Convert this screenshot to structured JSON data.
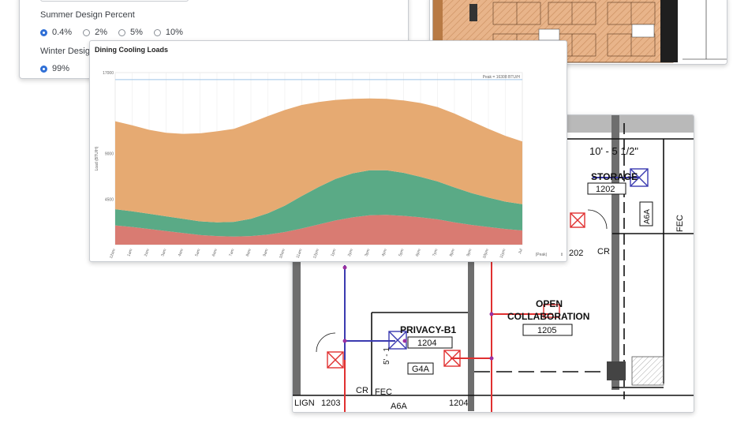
{
  "settings": {
    "summer_label": "Summer Design Percent",
    "summer_options": [
      "0.4%",
      "2%",
      "5%",
      "10%"
    ],
    "summer_selected": "0.4%",
    "winter_label": "Winter Design Percent",
    "winter_options": [
      "99%"
    ],
    "winter_selected": "99%"
  },
  "plan_thumb": {
    "labels": [
      "STORAGE",
      "OPEN\nCOLLABORATION"
    ],
    "accent": "#d9a172"
  },
  "floor_plan": {
    "rooms": [
      {
        "name": "STORAGE",
        "number": "1202"
      },
      {
        "name": "OPEN",
        "number": ""
      },
      {
        "name": "COLLABORATION",
        "number": "1205"
      },
      {
        "name": "PRIVACY-B1",
        "number": "1204"
      }
    ],
    "dimension": "10' - 5 1/2\"",
    "tags": [
      "A6A",
      "FEC",
      "CR",
      "202",
      "G4A",
      "CR",
      "FEC",
      "A6A",
      "1204",
      "1203",
      "LIGN",
      "5' - 1"
    ],
    "duct_colors": {
      "supply": "#e03030",
      "return": "#3a3ab0"
    }
  },
  "chart": {
    "title": "Dining Cooling Loads",
    "peak_label": "Peak = 16308 BTU/H",
    "ylabel": "Load (BTU/H)",
    "last_tick_sub": "(Peak)"
  },
  "chart_data": {
    "type": "area",
    "title": "Dining Cooling Loads",
    "ylabel": "Load (BTU/H)",
    "xlabel": "",
    "ylim": [
      0,
      17000
    ],
    "yticks": [
      4500,
      9000,
      17000
    ],
    "peak_value": 16308,
    "categories": [
      "12am",
      "1am",
      "2am",
      "3am",
      "4am",
      "5am",
      "6am",
      "7am",
      "8am",
      "9am",
      "10am",
      "11am",
      "12pm",
      "1pm",
      "2pm",
      "3pm",
      "4pm",
      "5pm",
      "6pm",
      "7pm",
      "8pm",
      "9pm",
      "10pm",
      "11pm",
      "Jul"
    ],
    "series": [
      {
        "color": "#d97b72",
        "values": [
          1900,
          1750,
          1550,
          1350,
          1150,
          950,
          850,
          800,
          850,
          1000,
          1250,
          1600,
          2000,
          2400,
          2700,
          2900,
          2950,
          2850,
          2700,
          2500,
          2200,
          1950,
          1750,
          1550,
          1400
        ]
      },
      {
        "color": "#5aaa86",
        "values": [
          1600,
          1550,
          1500,
          1450,
          1400,
          1350,
          1350,
          1450,
          1700,
          2100,
          2600,
          3200,
          3700,
          4100,
          4350,
          4450,
          4400,
          4250,
          4000,
          3750,
          3450,
          3150,
          2900,
          2700,
          2600
        ]
      },
      {
        "color": "#e6aa72",
        "values": [
          8700,
          8500,
          8300,
          8250,
          8400,
          8700,
          9000,
          9200,
          9500,
          9600,
          9450,
          9000,
          8400,
          7800,
          7350,
          7100,
          7050,
          7150,
          7300,
          7350,
          7300,
          7100,
          6800,
          6500,
          6200
        ]
      }
    ],
    "grid": true
  }
}
